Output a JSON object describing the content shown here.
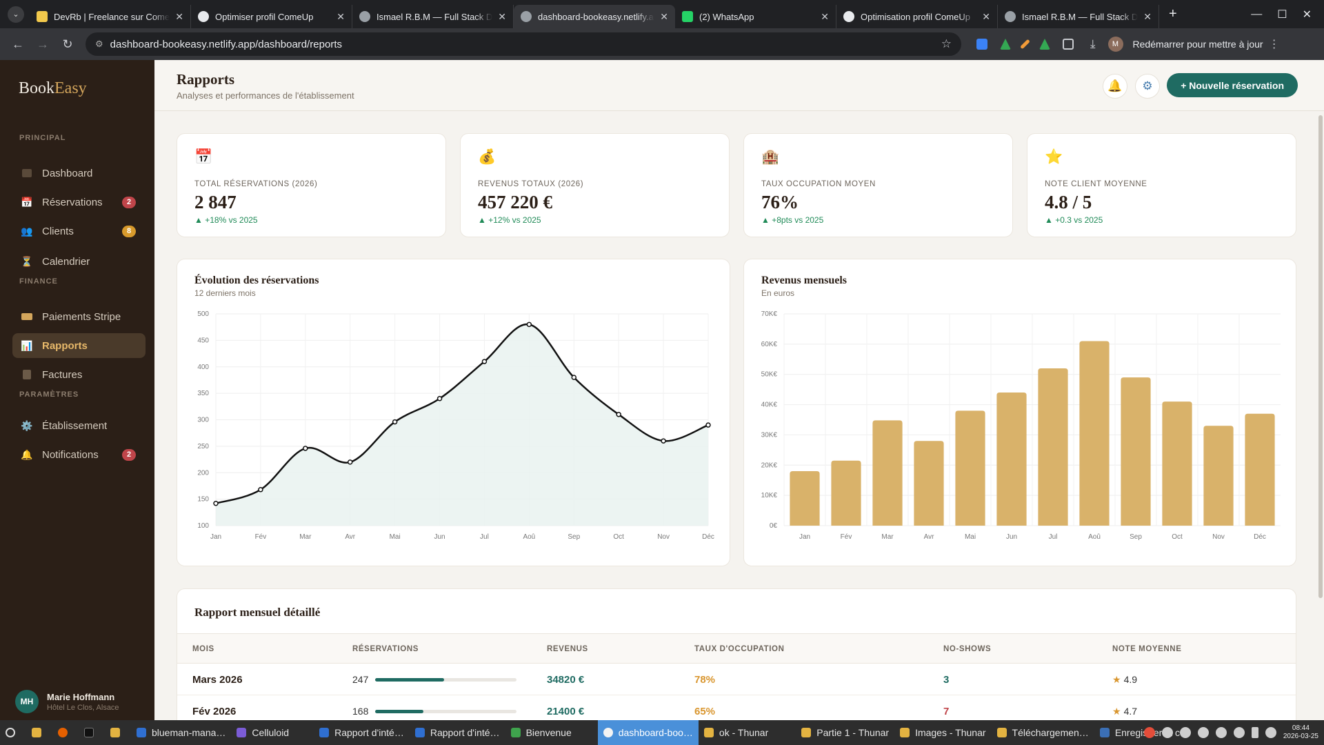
{
  "browser": {
    "tabs": [
      {
        "title": "DevRb | Freelance sur ComeUp",
        "color": "#f2c94c"
      },
      {
        "title": "Optimiser profil ComeUp",
        "color": "#e8eaed"
      },
      {
        "title": "Ismael R.B.M — Full Stack Developer",
        "color": "#9aa0a6"
      },
      {
        "title": "dashboard-bookeasy.netlify.app",
        "color": "#9aa0a6"
      },
      {
        "title": "(2) WhatsApp",
        "color": "#25d366"
      },
      {
        "title": "Optimisation profil ComeUp",
        "color": "#e8eaed"
      },
      {
        "title": "Ismael R.B.M — Full Stack Developer",
        "color": "#9aa0a6"
      }
    ],
    "url": "dashboard-bookeasy.netlify.app/dashboard/reports",
    "profile_initial": "M",
    "restart_label": "Redémarrer pour mettre à jour"
  },
  "sidebar": {
    "logo_a": "Book",
    "logo_b": "Easy",
    "sections": [
      "PRINCIPAL",
      "FINANCE",
      "PARAMÈTRES"
    ],
    "items": [
      {
        "label": "Dashboard",
        "icon": "dashboard-icon"
      },
      {
        "label": "Réservations",
        "icon": "calendar-icon",
        "badge": "2"
      },
      {
        "label": "Clients",
        "icon": "users-icon",
        "badge": "8"
      },
      {
        "label": "Calendrier",
        "icon": "hourglass-icon"
      },
      {
        "label": "Paiements Stripe",
        "icon": "card-icon"
      },
      {
        "label": "Rapports",
        "icon": "chart-icon"
      },
      {
        "label": "Factures",
        "icon": "invoice-icon"
      },
      {
        "label": "Établissement",
        "icon": "gear-icon"
      },
      {
        "label": "Notifications",
        "icon": "bell-icon",
        "badge": "2"
      }
    ],
    "user": {
      "initials": "MH",
      "name": "Marie Hoffmann",
      "sub": "Hôtel Le Clos, Alsace"
    }
  },
  "header": {
    "title": "Rapports",
    "subtitle": "Analyses et performances de l'établissement",
    "new_button": "+ Nouvelle réservation"
  },
  "kpis": [
    {
      "label": "TOTAL RÉSERVATIONS (2026)",
      "value": "2 847",
      "trend": "▲ +18% vs 2025",
      "icon": "📅"
    },
    {
      "label": "REVENUS TOTAUX (2026)",
      "value": "457 220 €",
      "trend": "▲ +12% vs 2025",
      "icon": "💰"
    },
    {
      "label": "TAUX OCCUPATION MOYEN",
      "value": "76%",
      "trend": "▲ +8pts vs 2025",
      "icon": "🏨"
    },
    {
      "label": "NOTE CLIENT MOYENNE",
      "value": "4.8 / 5",
      "trend": "▲ +0.3 vs 2025",
      "icon": "⭐"
    }
  ],
  "chart_data": [
    {
      "type": "area",
      "title": "Évolution des réservations",
      "subtitle": "12 derniers mois",
      "categories": [
        "Jan",
        "Fév",
        "Mar",
        "Avr",
        "Mai",
        "Jun",
        "Jul",
        "Aoû",
        "Sep",
        "Oct",
        "Nov",
        "Déc"
      ],
      "values": [
        142,
        168,
        246,
        220,
        296,
        340,
        410,
        480,
        380,
        310,
        260,
        290
      ],
      "ylim": [
        100,
        500
      ],
      "yticks": [
        100,
        150,
        200,
        250,
        300,
        350,
        400,
        450,
        500
      ],
      "grid": true,
      "color": "#111111"
    },
    {
      "type": "bar",
      "title": "Revenus mensuels",
      "subtitle": "En euros",
      "categories": [
        "Jan",
        "Fév",
        "Mar",
        "Avr",
        "Mai",
        "Jun",
        "Jul",
        "Aoû",
        "Sep",
        "Oct",
        "Nov",
        "Déc"
      ],
      "values": [
        18000,
        21500,
        34800,
        28000,
        38000,
        44000,
        52000,
        61000,
        49000,
        41000,
        33000,
        37000
      ],
      "ylim": [
        0,
        70000
      ],
      "ytick_labels": [
        "0€",
        "10K€",
        "20K€",
        "30K€",
        "40K€",
        "50K€",
        "60K€",
        "70K€"
      ],
      "grid": true,
      "color": "#d9b26a"
    }
  ],
  "table": {
    "title": "Rapport mensuel détaillé",
    "columns": [
      "MOIS",
      "RÉSERVATIONS",
      "REVENUS",
      "TAUX D'OCCUPATION",
      "NO-SHOWS",
      "NOTE MOYENNE"
    ],
    "rows": [
      {
        "mois": "Mars 2026",
        "reservations": "247",
        "bar": 0.49,
        "revenus": "34820 €",
        "occupation": "78%",
        "noshows": "3",
        "noshow_color": "#1f6b62",
        "note": "4.9"
      },
      {
        "mois": "Fév 2026",
        "reservations": "168",
        "bar": 0.34,
        "revenus": "21400 €",
        "occupation": "65%",
        "noshows": "7",
        "noshow_color": "#c0454a",
        "note": "4.7"
      }
    ]
  },
  "taskbar": {
    "items": [
      "blueman-mana…",
      "Celluloid",
      "Rapport d'inté…",
      "Rapport d'inté…",
      "Bienvenue",
      "dashboard-boo…",
      "ok - Thunar",
      "Partie 1 - Thunar",
      "Images - Thunar",
      "Téléchargemen…",
      "Enregistrer la c…"
    ],
    "time": "08:44",
    "date": "2026-03-25"
  }
}
